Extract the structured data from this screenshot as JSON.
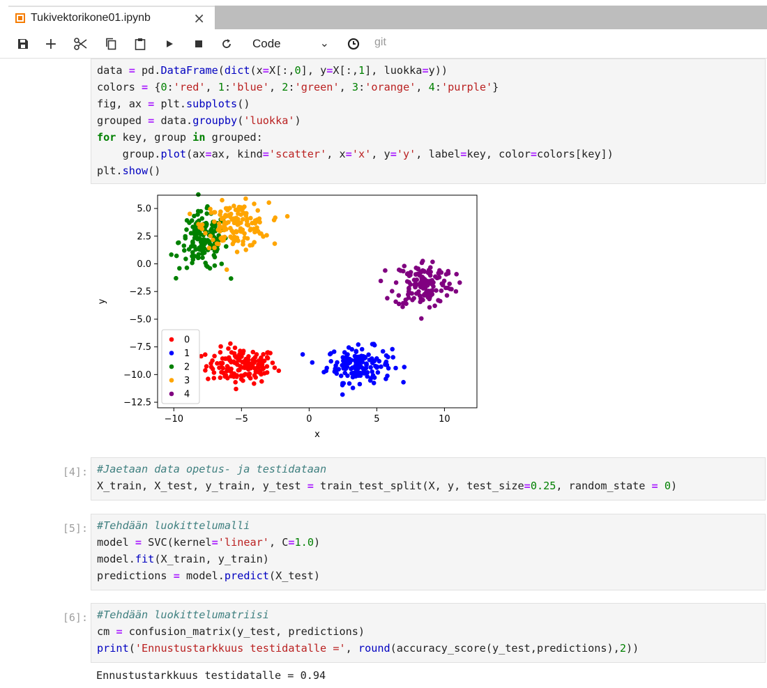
{
  "tab": {
    "title": "Tukivektorikone01.ipynb",
    "close": "×"
  },
  "toolbar": {
    "cell_type": "Code",
    "git": "git"
  },
  "cells": [
    {
      "prompt": "",
      "lines": [
        "data = pd.DataFrame(dict(x=X[:,0], y=X[:,1], luokka=y))",
        "colors = {0:'red', 1:'blue', 2:'green', 3:'orange', 4:'purple'}",
        "fig, ax = plt.subplots()",
        "grouped = data.groupby('luokka')",
        "for key, group in grouped:",
        "    group.plot(ax=ax, kind='scatter', x='x', y='y', label=key, color=colors[key])",
        "plt.show()"
      ]
    },
    {
      "prompt": "[4]:",
      "lines": [
        "#Jaetaan data opetus- ja testidataan",
        "X_train, X_test, y_train, y_test = train_test_split(X, y, test_size=0.25, random_state = 0)"
      ]
    },
    {
      "prompt": "[5]:",
      "lines": [
        "#Tehdään luokittelumalli",
        "model = SVC(kernel='linear', C=1.0)",
        "model.fit(X_train, y_train)",
        "predictions = model.predict(X_test)"
      ]
    },
    {
      "prompt": "[6]:",
      "lines": [
        "#Tehdään luokittelumatriisi",
        "cm = confusion_matrix(y_test, predictions)",
        "print('Ennustustarkkuus testidatalle =', round(accuracy_score(y_test,predictions),2))"
      ],
      "output": "Ennustustarkkuus testidatalle = 0.94"
    }
  ],
  "colors": {
    "red": "#ff0000",
    "blue": "#0000ff",
    "green": "#008000",
    "orange": "#ffa500",
    "purple": "#800080"
  },
  "chart_data": {
    "type": "scatter",
    "xlabel": "x",
    "ylabel": "y",
    "xlim": [
      -11.2,
      12.4
    ],
    "ylim": [
      -13,
      6.2
    ],
    "xticks": [
      -10,
      -5,
      0,
      5,
      10
    ],
    "yticks": [
      5.0,
      2.5,
      0.0,
      -2.5,
      -5.0,
      -7.5,
      -10.0,
      -12.5
    ],
    "xtick_labels": [
      "−10",
      "−5",
      "0",
      "5",
      "10"
    ],
    "ytick_labels": [
      "5.0",
      "2.5",
      "0.0",
      "−2.5",
      "−5.0",
      "−7.5",
      "−10.0",
      "−12.5"
    ],
    "legend_position": "lower-left",
    "series": [
      {
        "name": "0",
        "color": "#ff0000",
        "center": [
          -5.0,
          -9.2
        ],
        "spread": [
          1.3,
          0.8
        ],
        "n": 150
      },
      {
        "name": "1",
        "color": "#0000ff",
        "center": [
          3.7,
          -9.1
        ],
        "spread": [
          1.2,
          0.8
        ],
        "n": 150
      },
      {
        "name": "2",
        "color": "#008000",
        "center": [
          -7.8,
          2.0
        ],
        "spread": [
          0.9,
          1.3
        ],
        "n": 150
      },
      {
        "name": "3",
        "color": "#ffa500",
        "center": [
          -5.4,
          3.5
        ],
        "spread": [
          1.2,
          1.0
        ],
        "n": 150
      },
      {
        "name": "4",
        "color": "#800080",
        "center": [
          8.5,
          -1.8
        ],
        "spread": [
          1.1,
          1.1
        ],
        "n": 150
      }
    ]
  }
}
